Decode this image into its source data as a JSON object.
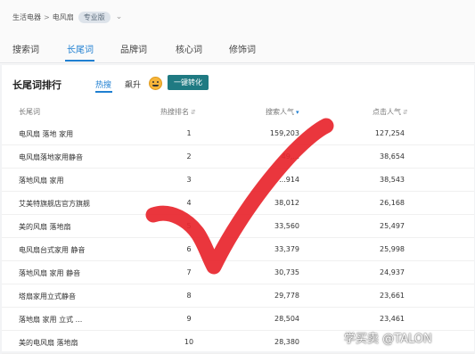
{
  "breadcrumb": {
    "category": "生活电器",
    "sep": ">",
    "subcategory": "电风扇",
    "badge": "专业版"
  },
  "tabs": [
    "搜索词",
    "长尾词",
    "品牌词",
    "核心词",
    "修饰词"
  ],
  "active_tab": "长尾词",
  "section": {
    "title": "长尾词排行",
    "subtabs": [
      "热搜",
      "飙升"
    ],
    "active_subtab": "热搜",
    "convert_button": "一键转化"
  },
  "table": {
    "headers": [
      "长尾词",
      "热搜排名",
      "搜索人气",
      "点击人气"
    ],
    "rows": [
      {
        "keyword": "电风扇 落地 家用",
        "rank": "1",
        "search": "159,203",
        "click": "127,254"
      },
      {
        "keyword": "电风扇落地家用静音",
        "rank": "2",
        "search": "49,...",
        "click": "38,654"
      },
      {
        "keyword": "落地风扇 家用",
        "rank": "3",
        "search": "...914",
        "click": "38,543"
      },
      {
        "keyword": "艾美特旗舰店官方旗舰",
        "rank": "4",
        "search": "38,012",
        "click": "26,168"
      },
      {
        "keyword": "美的风扇 落地扇",
        "rank": "5",
        "search": "33,560",
        "click": "25,497"
      },
      {
        "keyword": "电风扇台式家用 静音",
        "rank": "6",
        "search": "33,379",
        "click": "25,998"
      },
      {
        "keyword": "落地风扇 家用 静音",
        "rank": "7",
        "search": "30,735",
        "click": "24,937"
      },
      {
        "keyword": "塔扇家用立式静音",
        "rank": "8",
        "search": "29,778",
        "click": "23,661"
      },
      {
        "keyword": "落地扇 家用 立式 ...",
        "rank": "9",
        "search": "28,504",
        "click": "23,461"
      },
      {
        "keyword": "美的电风扇 落地扇",
        "rank": "10",
        "search": "28,380",
        "click": ""
      }
    ]
  },
  "watermark": "学买卖 @TALON",
  "colors": {
    "accent": "#1f7fd1",
    "button": "#1f7a82",
    "checkmark": "#e8252c"
  },
  "icons": {
    "sort": "sort-icon",
    "dropdown": "chevron-down-icon",
    "mascot": "emoji-face-icon"
  }
}
